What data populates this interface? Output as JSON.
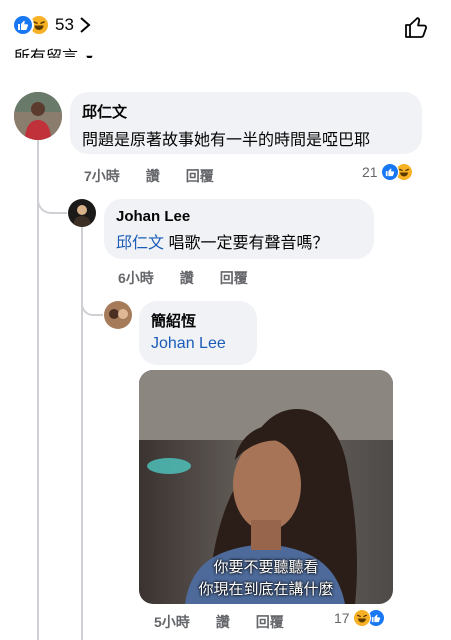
{
  "header": {
    "reaction_count": "53",
    "sort_label": "所有留言"
  },
  "comments": [
    {
      "author": "邱仁文",
      "text": "問題是原著故事她有一半的時間是啞巴耶",
      "time": "7小時",
      "like_label": "讚",
      "reply_label": "回覆",
      "reaction_count": "21"
    },
    {
      "author": "Johan Lee",
      "mention": "邱仁文",
      "text": " 唱歌一定要有聲音嗎？",
      "time": "6小時",
      "like_label": "讚",
      "reply_label": "回覆"
    },
    {
      "author": "簡紹恆",
      "mention": "Johan Lee",
      "image_caption_line1": "你要不要聽聽看",
      "image_caption_line2": "你現在到底在講什麼",
      "time": "5小時",
      "like_label": "讚",
      "reply_label": "回覆",
      "reaction_count": "17"
    }
  ],
  "colors": {
    "like_blue": "#1877f2",
    "haha_yellow": "#f7b125",
    "bubble_bg": "#f0f2f5",
    "meta_gray": "#65676b",
    "mention_blue": "#1a5cb8"
  }
}
